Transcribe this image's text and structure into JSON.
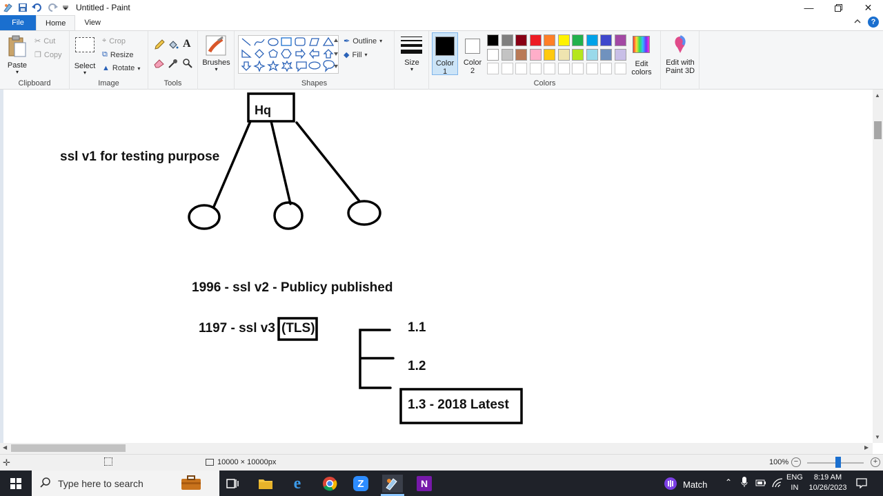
{
  "window": {
    "title": "Untitled - Paint"
  },
  "tabs": {
    "file": "File",
    "home": "Home",
    "view": "View"
  },
  "clipboard": {
    "paste": "Paste",
    "cut": "Cut",
    "copy": "Copy",
    "label": "Clipboard"
  },
  "image": {
    "select": "Select",
    "crop": "Crop",
    "resize": "Resize",
    "rotate": "Rotate",
    "label": "Image"
  },
  "tools": {
    "label": "Tools"
  },
  "brushes": {
    "label": "Brushes"
  },
  "shapes": {
    "outline": "Outline",
    "fill": "Fill",
    "label": "Shapes"
  },
  "size": {
    "label": "Size"
  },
  "colors": {
    "color1": "Color 1",
    "color1_line1": "Color",
    "color1_line2": "1",
    "color2_line1": "Color",
    "color2_line2": "2",
    "edit_colors_line1": "Edit",
    "edit_colors_line2": "colors",
    "paint3d_line1": "Edit with",
    "paint3d_line2": "Paint 3D",
    "label": "Colors",
    "palette_row1": [
      "#000000",
      "#7f7f7f",
      "#880015",
      "#ed1c24",
      "#ff7f27",
      "#fff200",
      "#22b14c",
      "#00a2e8",
      "#3f48cc",
      "#a349a4"
    ],
    "palette_row2": [
      "#ffffff",
      "#c3c3c3",
      "#b97a57",
      "#ffaec9",
      "#ffc90e",
      "#efe4b0",
      "#b5e61d",
      "#99d9ea",
      "#7092be",
      "#c8bfe7"
    ],
    "primary": "#000000",
    "secondary": "#ffffff"
  },
  "canvas": {
    "hq": "Hq",
    "ssl_v1": "ssl v1 for testing purpose",
    "ssl_v2": "1996 - ssl v2 - Publicy published",
    "ssl_v3": "1197 - ssl v3",
    "tls": "(TLS)",
    "v11": "1.1",
    "v12": "1.2",
    "v13": "1.3 - 2018 Latest"
  },
  "status": {
    "dimensions": "10000 × 10000px",
    "zoom": "100%",
    "zoom_level": 0.55
  },
  "taskbar": {
    "search_placeholder": "Type here to search",
    "match": "Match",
    "lang1": "ENG",
    "lang2": "IN",
    "time": "8:19 AM",
    "date": "10/26/2023"
  }
}
